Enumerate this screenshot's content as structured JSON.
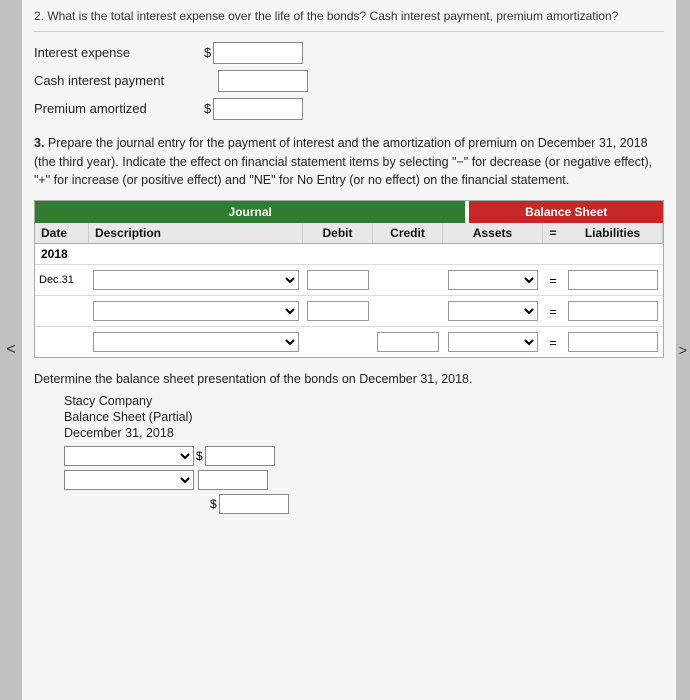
{
  "top_text": "2. What is the total interest expense over the life of the bonds? Cash interest payment, premium amortization?",
  "fields": [
    {
      "label": "Interest expense",
      "has_dollar": true
    },
    {
      "label": "Cash interest payment",
      "has_dollar": false
    },
    {
      "label": "Premium amortized",
      "has_dollar": true
    }
  ],
  "question3_text": "3.  Prepare the journal entry for the payment of interest and the amortization of premium on December 31, 2018 (the third year). Indicate the effect on financial statement items by selecting \"-\" for decrease (or negative effect), \"+\" for increase (or positive effect) and \"NE\" for No Entry (or no effect) on the financial statement.",
  "journal_header": "Journal",
  "balance_header": "Balance Sheet",
  "columns": {
    "date": "Date",
    "description": "Description",
    "debit": "Debit",
    "credit": "Credit",
    "assets": "Assets",
    "equals": "=",
    "liabilities": "Liabilities"
  },
  "year": "2018",
  "month_day": [
    "Dec.",
    "31"
  ],
  "data_rows": [
    {
      "date": "Dec.",
      "date2": "31",
      "is_main": true
    },
    {
      "date": "",
      "date2": "",
      "is_main": false
    },
    {
      "date": "",
      "date2": "",
      "is_main": false
    }
  ],
  "determine_text": "Determine the balance sheet presentation of the bonds on December 31, 2018.",
  "balance_sheet": {
    "company": "Stacy Company",
    "title": "Balance Sheet (Partial)",
    "date": "December 31, 2018"
  },
  "nav_left": "<",
  "nav_right": ">"
}
